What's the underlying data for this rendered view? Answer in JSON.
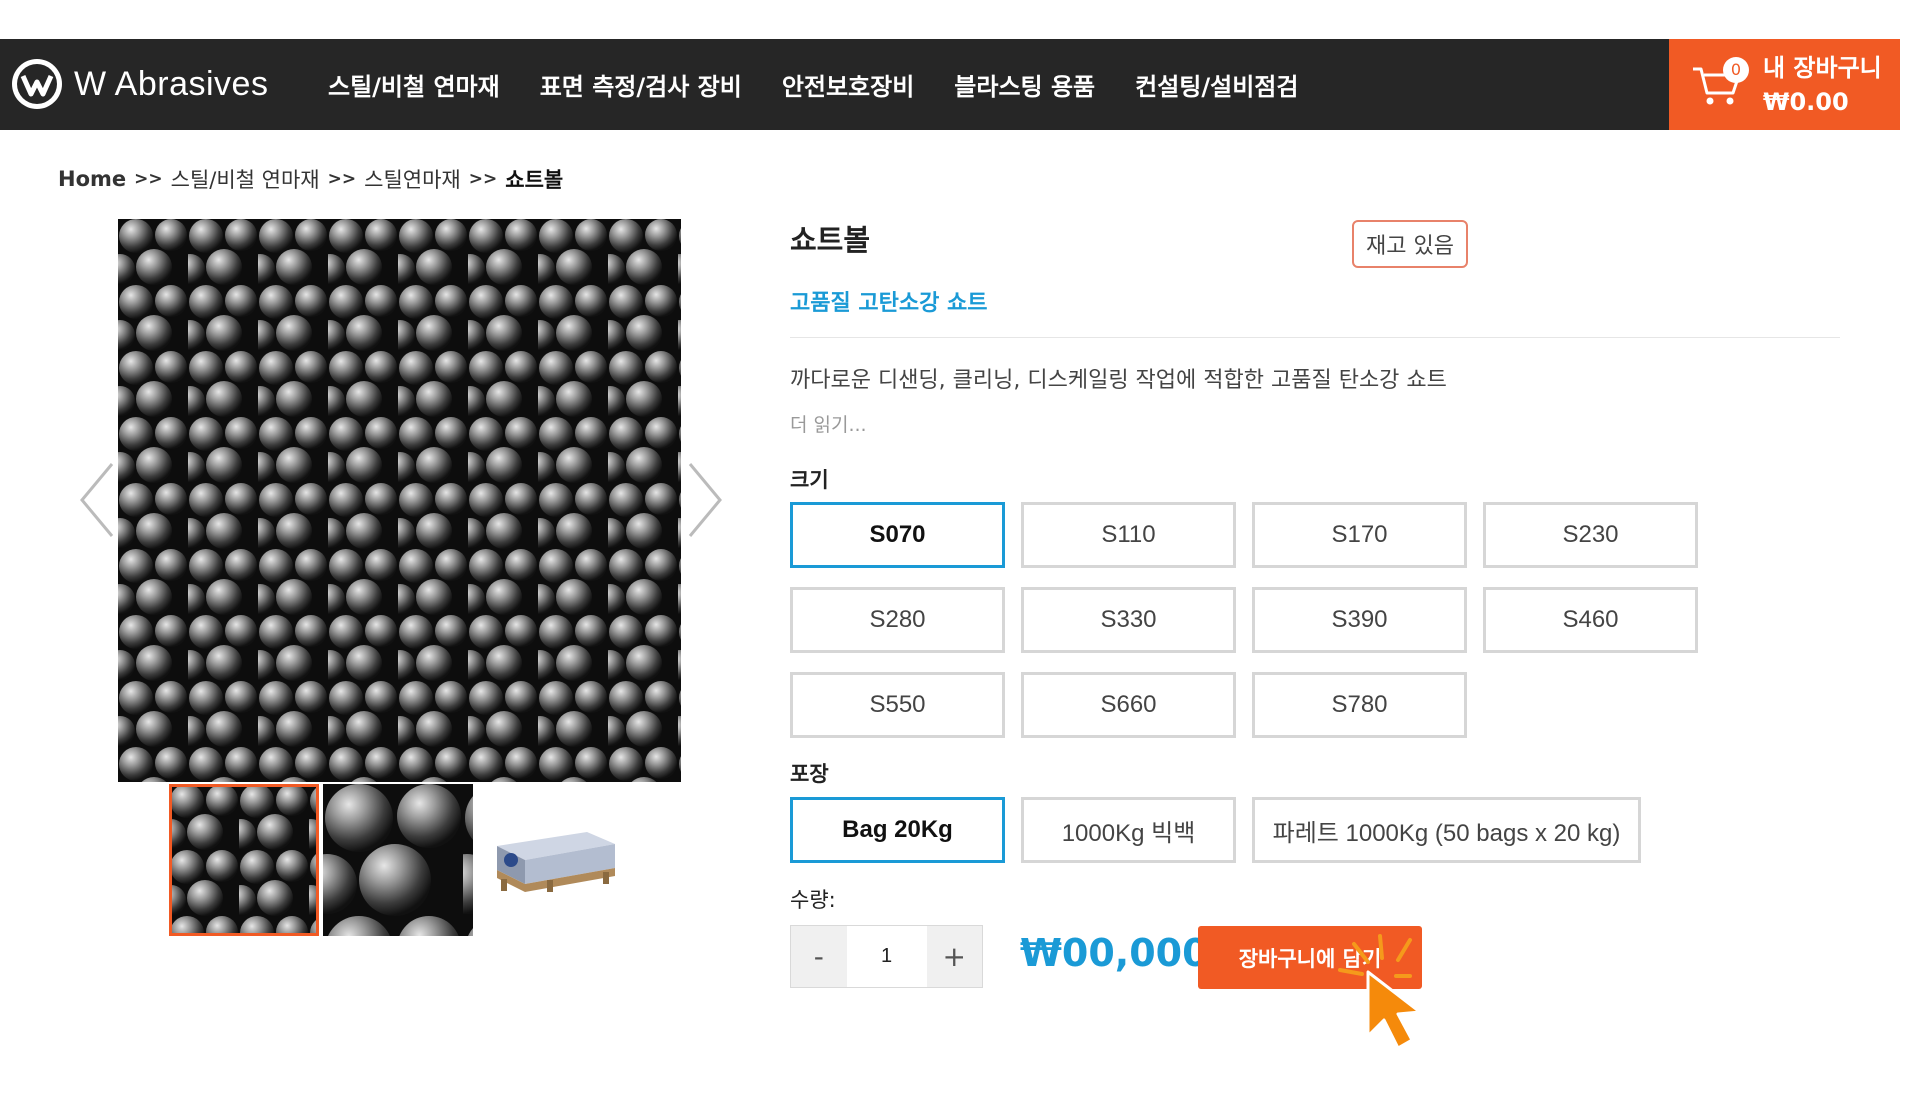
{
  "brand": {
    "name": "W Abrasives"
  },
  "nav": {
    "items": [
      {
        "label": "스틸/비철 연마재"
      },
      {
        "label": "표면 측정/검사 장비"
      },
      {
        "label": "안전보호장비"
      },
      {
        "label": "블라스팅 용품"
      },
      {
        "label": "컨설팅/설비점검"
      }
    ]
  },
  "cart": {
    "count": "0",
    "label": "내 장바구니",
    "total": "₩0.00"
  },
  "breadcrumb": {
    "home": "Home",
    "separator": ">>",
    "level1": "스틸/비철 연마재",
    "level2": "스틸연마재",
    "current": "쇼트볼"
  },
  "product": {
    "title": "쇼트볼",
    "stock": "재고 있음",
    "subtitle": "고품질 고탄소강 쇼트",
    "description": "까다로운 디샌딩, 클리닝, 디스케일링 작업에 적합한 고품질 탄소강 쇼트",
    "read_more": "더 읽기..."
  },
  "options": {
    "size_label": "크기",
    "sizes": [
      "S070",
      "S110",
      "S170",
      "S230",
      "S280",
      "S330",
      "S390",
      "S460",
      "S550",
      "S660",
      "S780"
    ],
    "selected_size": "S070",
    "pack_label": "포장",
    "packs": [
      "Bag 20Kg",
      "1000Kg 빅백",
      "파레트 1000Kg (50 bags x 20 kg)"
    ],
    "selected_pack": "Bag 20Kg"
  },
  "purchase": {
    "qty_label": "수량:",
    "minus": "-",
    "plus": "+",
    "qty_value": "1",
    "price": "₩00,000",
    "add_to_cart": "장바구니에 담기"
  },
  "colors": {
    "accent": "#f15a24",
    "link": "#1a9ad6",
    "header_bg": "#262626"
  }
}
